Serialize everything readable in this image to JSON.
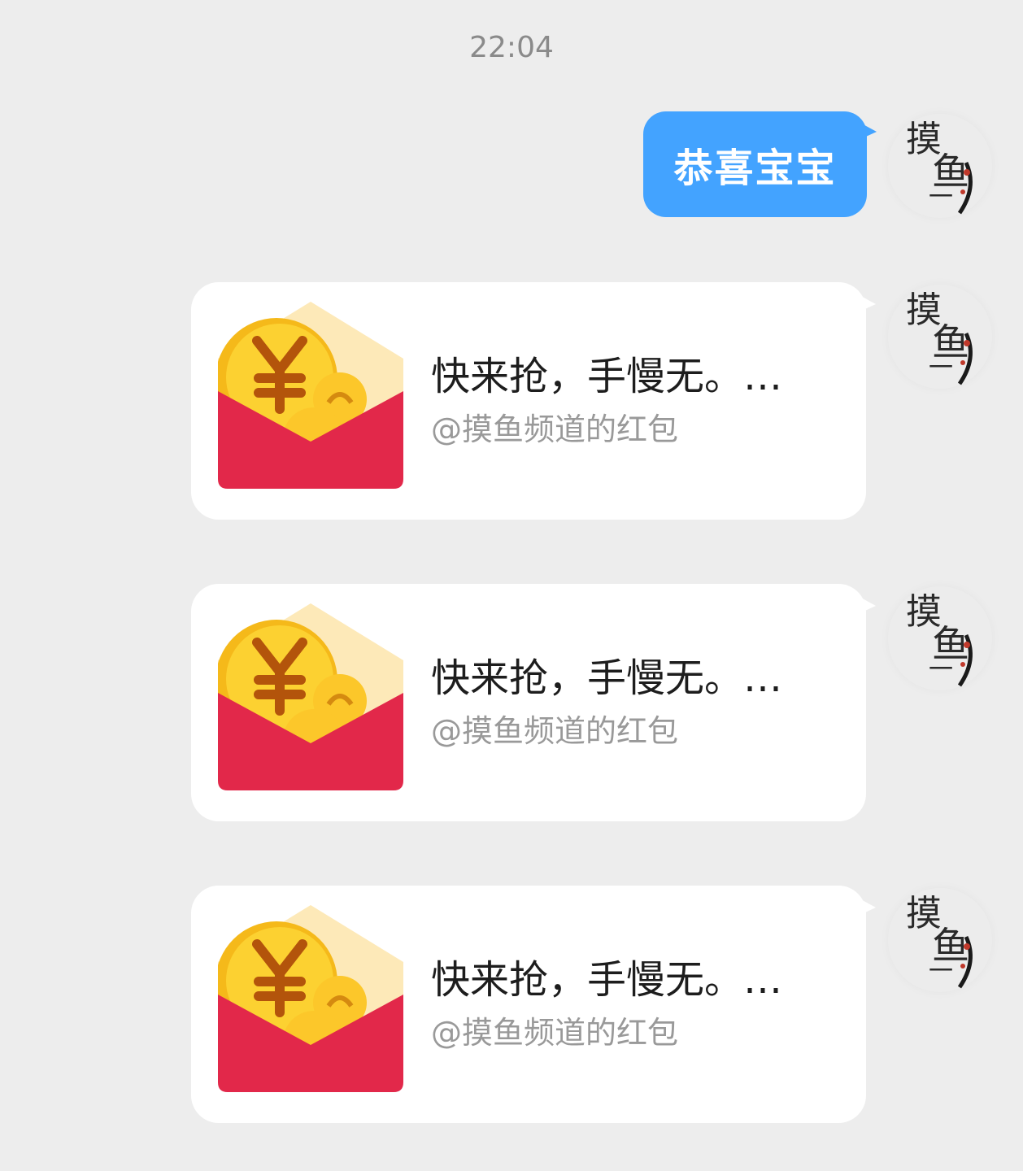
{
  "chat": {
    "timestamp": "22:04",
    "text_message": "恭喜宝宝",
    "avatar_text": [
      "摸",
      "鱼",
      "一"
    ],
    "red_packets": [
      {
        "title": "快来抢，手慢无。…",
        "subtitle": "@摸鱼频道的红包"
      },
      {
        "title": "快来抢，手慢无。…",
        "subtitle": "@摸鱼频道的红包"
      },
      {
        "title": "快来抢，手慢无。…",
        "subtitle": "@摸鱼频道的红包"
      }
    ]
  },
  "colors": {
    "background": "#ededed",
    "bubble_blue": "#43a3ff",
    "envelope_red": "#e2284a",
    "envelope_back": "#fde9b8",
    "coin_gold": "#f9c41d",
    "yen_brown": "#b3540b"
  },
  "icons": {
    "envelope": "red-envelope-icon",
    "avatar": "moyu-avatar"
  }
}
